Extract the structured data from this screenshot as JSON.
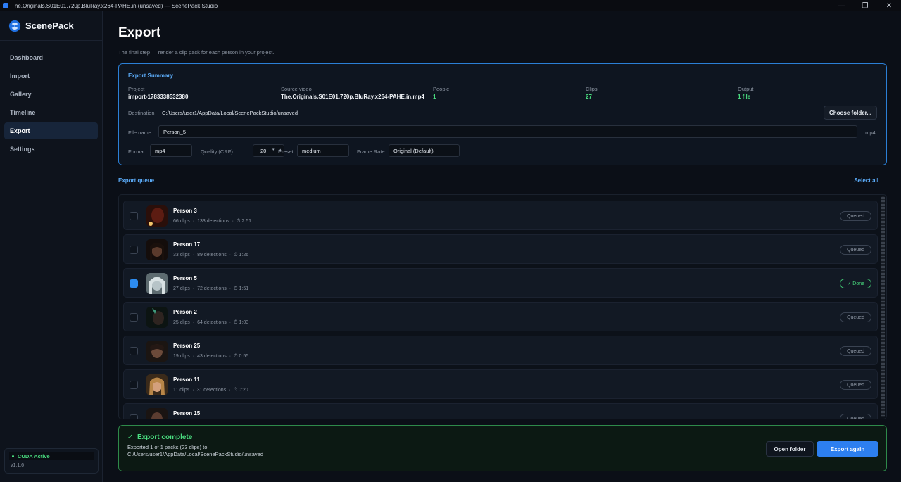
{
  "window": {
    "title": "The.Originals.S01E01.720p.BluRay.x264-PAHE.in (unsaved) — ScenePack Studio",
    "minimize": "—",
    "maximize": "❐",
    "close": "✕"
  },
  "sidebar": {
    "brand": "ScenePack",
    "items": [
      {
        "label": "Dashboard"
      },
      {
        "label": "Import"
      },
      {
        "label": "Gallery"
      },
      {
        "label": "Timeline"
      },
      {
        "label": "Export"
      },
      {
        "label": "Settings"
      }
    ],
    "active": "Export",
    "status": "CUDA Active",
    "version": "v1.1.6"
  },
  "page": {
    "title": "Export",
    "subtitle": "The final step — render a clip pack for each person in your project."
  },
  "summary": {
    "title": "Export Summary",
    "project_label": "Project",
    "project_value": "import-1783338532380",
    "source_label": "Source video",
    "source_value": "The.Originals.S01E01.720p.BluRay.x264-PAHE.in.mp4",
    "people_label": "People",
    "people_value": "1",
    "clips_label": "Clips",
    "clips_value": "27",
    "output_label": "Output",
    "output_value": "1 file",
    "destination_label": "Destination",
    "destination_value": "C:/Users/user1/AppData/Local/ScenePackStudio/unsaved",
    "choose_folder": "Choose folder...",
    "filename_label": "File name",
    "filename_value": "Person_5",
    "extension": ".mp4",
    "format_label": "Format",
    "format_value": "mp4",
    "quality_label": "Quality (CRF)",
    "quality_value": "20",
    "preset_label": "Preset",
    "preset_value": "medium",
    "framerate_label": "Frame Rate",
    "framerate_value": "Original (Default)"
  },
  "queue": {
    "title": "Export queue",
    "select_all": "Select all",
    "rows": [
      {
        "name": "Person 3",
        "clips": "66 clips",
        "detections": "133 detections",
        "duration": "2:51",
        "status": "Queued",
        "checked": false
      },
      {
        "name": "Person 17",
        "clips": "33 clips",
        "detections": "89 detections",
        "duration": "1:26",
        "status": "Queued",
        "checked": false
      },
      {
        "name": "Person 5",
        "clips": "27 clips",
        "detections": "72 detections",
        "duration": "1:51",
        "status": "✓ Done",
        "checked": true
      },
      {
        "name": "Person 2",
        "clips": "25 clips",
        "detections": "64 detections",
        "duration": "1:03",
        "status": "Queued",
        "checked": false
      },
      {
        "name": "Person 25",
        "clips": "19 clips",
        "detections": "43 detections",
        "duration": "0:55",
        "status": "Queued",
        "checked": false
      },
      {
        "name": "Person 11",
        "clips": "11 clips",
        "detections": "31 detections",
        "duration": "0:20",
        "status": "Queued",
        "checked": false
      },
      {
        "name": "Person 15",
        "clips": "",
        "detections": "",
        "duration": "",
        "status": "Queued",
        "checked": false
      }
    ]
  },
  "complete": {
    "title": "Export complete",
    "message": "Exported 1 of 1 packs (23 clips) to C:/Users/user1/AppData/Local/ScenePackStudio/unsaved",
    "open_folder": "Open folder",
    "export_again": "Export again"
  },
  "colors": {
    "accent": "#2d7ff0",
    "success": "#4ade80",
    "background": "#0b0f17"
  }
}
